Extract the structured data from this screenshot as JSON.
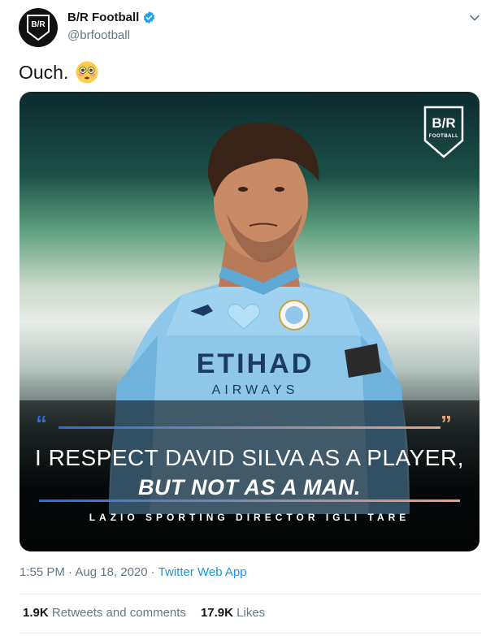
{
  "account": {
    "name": "B/R Football",
    "handle": "@brfootball",
    "avatar_text": "B/R",
    "verified": true
  },
  "tweet": {
    "text": "Ouch.",
    "emoji": "flushed-face-emoji"
  },
  "media": {
    "logo_text": "B/R",
    "logo_subtext": "FOOTBALL",
    "quote_line1": "I RESPECT DAVID SILVA AS A PLAYER,",
    "quote_line2": "BUT NOT AS A MAN.",
    "credit": "LAZIO SPORTING DIRECTOR IGLI TARE",
    "shirt_sponsor_line1": "ETIHAD",
    "shirt_sponsor_line2": "AIRWAYS"
  },
  "meta": {
    "time_date": "1:55 PM · Aug 18, 2020 · ",
    "app": "Twitter Web App"
  },
  "stats": {
    "retweets_count": "1.9K",
    "retweets_label": "Retweets and comments",
    "likes_count": "17.9K",
    "likes_label": "Likes"
  },
  "colors": {
    "accent": "#1da1f2",
    "secondary_text": "#657786",
    "text": "#14171a",
    "quote_rule_left": "#2a6fd6",
    "quote_rule_right": "#e8a37c"
  }
}
